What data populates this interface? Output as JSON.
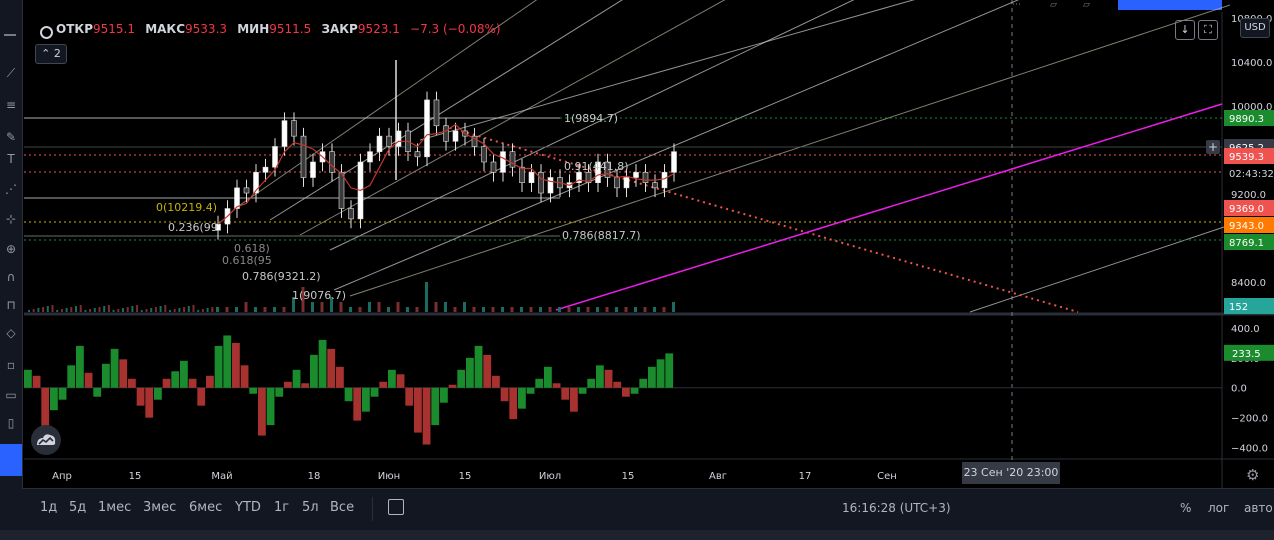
{
  "legend": {
    "open_label": "ОТКР",
    "open_value": "9515.1",
    "high_label": "МАКС",
    "high_value": "9533.3",
    "low_label": "МИН",
    "low_value": "9511.5",
    "close_label": "ЗАКР",
    "close_value": "9523.1",
    "change_value": "−7.3 (−0.08%)"
  },
  "indicators_badge": "2",
  "currency": "USD",
  "colors": {
    "up": "#26a69a",
    "down": "#ef5350",
    "price_line": "#ef5350",
    "fib": "#f0f0f0",
    "trend_pink": "#e91ee9",
    "hist_up": "#1b8c2e",
    "hist_down": "#a83230"
  },
  "chart_data": [
    {
      "type": "candlestick",
      "title": "",
      "x_ticks": [
        "Апр",
        "15",
        "Май",
        "18",
        "Июн",
        "15",
        "Июл",
        "15",
        "Авг",
        "17",
        "Сен"
      ],
      "y_ticks": [
        "10800.0",
        "10400.0",
        "10000.0",
        "9200.0",
        "8400.0"
      ],
      "ylim": [
        8000,
        10900
      ],
      "price_labels": [
        {
          "value": "9890.3",
          "color": "#1b8c2e"
        },
        {
          "value": "9625.2",
          "color": "#363a45"
        },
        {
          "value": "9539.3",
          "color": "#ef5350"
        },
        {
          "value": "02:43:32",
          "color": "#000000"
        },
        {
          "value": "9369.0",
          "color": "#ef5350"
        },
        {
          "value": "9343.0",
          "color": "#ff7a00"
        },
        {
          "value": "8769.1",
          "color": "#1b8c2e"
        },
        {
          "value": "152",
          "color": "#26a69a"
        }
      ],
      "fib_labels": [
        "1(9894.7)",
        "0.91(441.8)",
        "0(10219.4)",
        "0.236(99",
        "0.786(8817.7)",
        "0.786(9321.2)",
        "1(9076.7)",
        "0.618(95",
        "0.618)"
      ],
      "close_path": [
        8850,
        9000,
        9200,
        9150,
        9350,
        9400,
        9600,
        9850,
        9700,
        9300,
        9450,
        9550,
        9350,
        9000,
        8900,
        9450,
        9550,
        9700,
        9600,
        9750,
        9550,
        9500,
        10050,
        9800,
        9650,
        9750,
        9700,
        9600,
        9450,
        9350,
        9550,
        9400,
        9250,
        9350,
        9150,
        9300,
        9200,
        9250,
        9350,
        9250,
        9450,
        9300,
        9200,
        9300,
        9350,
        9250,
        9200,
        9350,
        9550
      ],
      "volume": [
        1,
        1,
        1,
        2,
        1,
        1,
        1,
        1,
        3,
        5,
        2,
        2,
        3,
        2,
        1,
        1,
        2,
        2,
        1,
        2,
        1,
        1,
        6,
        2,
        2,
        1,
        2,
        1,
        1,
        1,
        1,
        1,
        1,
        1,
        1,
        1,
        1,
        1,
        1,
        1,
        1,
        1,
        1,
        1,
        1,
        1,
        1,
        1,
        2
      ]
    },
    {
      "type": "bar",
      "title": "",
      "y_ticks": [
        "400.0",
        "200.0",
        "0.0",
        "−200.0",
        "−400.0"
      ],
      "ylim": [
        -470,
        480
      ],
      "current_label": "233.5",
      "values": [
        120,
        80,
        -260,
        -150,
        -80,
        150,
        280,
        100,
        -60,
        160,
        260,
        190,
        60,
        -120,
        -200,
        -80,
        60,
        110,
        180,
        60,
        -120,
        80,
        280,
        350,
        300,
        150,
        -40,
        -320,
        -250,
        -60,
        40,
        120,
        30,
        220,
        320,
        260,
        140,
        -90,
        -220,
        -160,
        -60,
        40,
        120,
        90,
        -120,
        -300,
        -380,
        -250,
        -100,
        20,
        120,
        200,
        280,
        220,
        80,
        -90,
        -210,
        -140,
        -40,
        60,
        140,
        30,
        -80,
        -160,
        -40,
        60,
        150,
        120,
        40,
        -60,
        -40,
        60,
        140,
        190,
        230
      ]
    }
  ],
  "time_axis_tip": "23 Сен '20   23:00",
  "bottom": {
    "periods": [
      "1д",
      "5д",
      "1мес",
      "3мес",
      "6мес",
      "YTD",
      "1г",
      "5л",
      "Все"
    ],
    "clock": "16:16:28 (UTC+3)",
    "percent": "%",
    "log": "лог",
    "auto": "авто"
  }
}
